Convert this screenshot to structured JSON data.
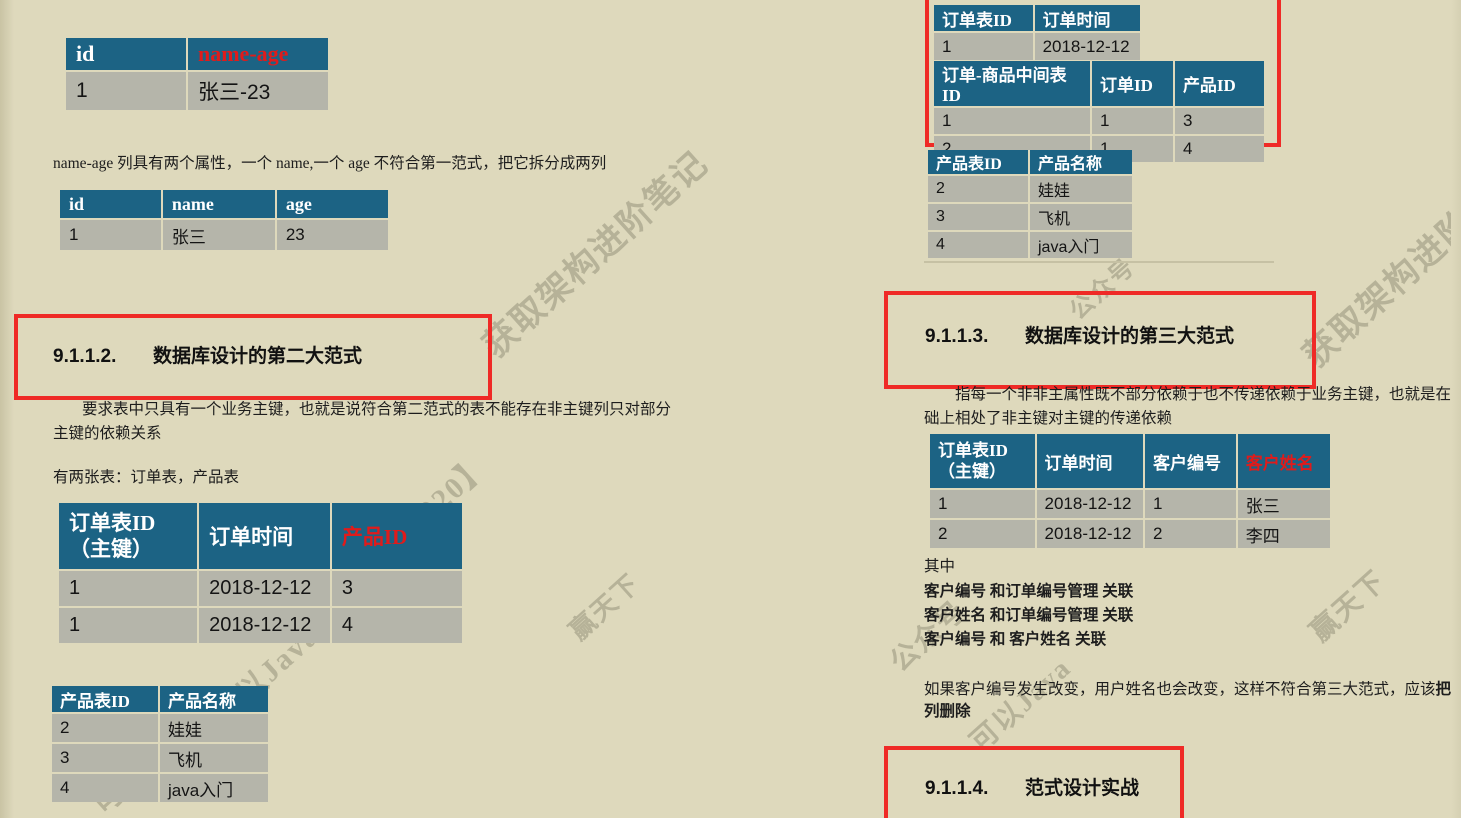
{
  "page": {
    "background_color": "#ded9bc",
    "table_header_color": "#1c6384",
    "table_row_color": "#b5b5aa",
    "accent_red": "#e01b1b",
    "highlight_box_color": "#ef2a26"
  },
  "watermarks": [
    {
      "text": "获取架构进阶笔记"
    },
    {
      "text": "可以Java"
    },
    {
      "text": "公众号"
    },
    {
      "text": "【2020】"
    },
    {
      "text": "赢天下"
    }
  ],
  "left_column": {
    "table_nameage": {
      "headers": [
        "id",
        "name-age"
      ],
      "header_colors": [
        "normal",
        "red"
      ],
      "rows": [
        {
          "cells": [
            "1",
            "张三-23"
          ],
          "cell_colors": [
            "normal",
            "red"
          ]
        }
      ]
    },
    "note_first_normal_form": "name-age 列具有两个属性，一个 name,一个 age 不符合第一范式，把它拆分成两列",
    "table_split": {
      "headers": [
        "id",
        "name",
        "age"
      ],
      "rows": [
        {
          "cells": [
            "1",
            "张三",
            "23"
          ]
        }
      ]
    },
    "heading_2nf": {
      "number": "9.1.1.2.",
      "title": "数据库设计的第二大范式"
    },
    "para_2nf_line1": "要求表中只具有一个业务主键，也就是说符合第二范式的表不能存在非主键列只对部分",
    "para_2nf_line2": "主键的依赖关系",
    "para_two_tables": "有两张表：订单表，产品表",
    "table_order_left": {
      "headers": [
        "订单表ID\n（主键）",
        "订单时间",
        "产品ID"
      ],
      "header_lines": [
        [
          "订单表ID",
          "（主键）"
        ],
        [
          "订单时间"
        ],
        [
          "产品ID"
        ]
      ],
      "header_colors": [
        "normal",
        "normal",
        "red"
      ],
      "rows": [
        {
          "cells": [
            "1",
            "2018-12-12",
            "3"
          ],
          "cell_colors": [
            "normal",
            "normal",
            "red"
          ]
        },
        {
          "cells": [
            "1",
            "2018-12-12",
            "4"
          ],
          "cell_colors": [
            "red",
            "normal",
            "red"
          ]
        }
      ]
    },
    "table_product_left": {
      "headers": [
        "产品表ID",
        "产品名称"
      ],
      "rows": [
        {
          "cells": [
            "2",
            "娃娃"
          ]
        },
        {
          "cells": [
            "3",
            "飞机"
          ]
        },
        {
          "cells": [
            "4",
            "java入门"
          ]
        }
      ]
    }
  },
  "right_column": {
    "table_order_top": {
      "headers": [
        "订单表ID",
        "订单时间"
      ],
      "rows": [
        {
          "cells": [
            "1",
            "2018-12-12"
          ]
        }
      ]
    },
    "table_order_product_link": {
      "headers": [
        "订单-商品中间表ID",
        "订单ID",
        "产品ID"
      ],
      "rows": [
        {
          "cells": [
            "1",
            "1",
            "3"
          ]
        },
        {
          "cells": [
            "2",
            "1",
            "4"
          ]
        }
      ]
    },
    "table_product_right": {
      "headers": [
        "产品表ID",
        "产品名称"
      ],
      "rows": [
        {
          "cells": [
            "2",
            "娃娃"
          ]
        },
        {
          "cells": [
            "3",
            "飞机"
          ]
        },
        {
          "cells": [
            "4",
            "java入门"
          ]
        }
      ]
    },
    "heading_3nf": {
      "number": "9.1.1.3.",
      "title": "数据库设计的第三大范式"
    },
    "para_3nf_line1": "指每一个非非主属性既不部分依赖于也不传递依赖于业务主键，也就是在第",
    "para_3nf_line2": "础上相处了非主键对主键的传递依赖",
    "table_customer": {
      "headers": [
        "订单表ID\n（主键）",
        "订单时间",
        "客户编号",
        "客户姓名"
      ],
      "header_lines": [
        [
          "订单表ID",
          "（主键）"
        ],
        [
          "订单时间"
        ],
        [
          "客户编号"
        ],
        [
          "客户姓名"
        ]
      ],
      "header_colors": [
        "normal",
        "normal",
        "normal",
        "red"
      ],
      "rows": [
        {
          "cells": [
            "1",
            "2018-12-12",
            "1",
            "张三"
          ],
          "cell_colors": [
            "normal",
            "normal",
            "normal",
            "red"
          ]
        },
        {
          "cells": [
            "2",
            "2018-12-12",
            "2",
            "李四"
          ],
          "cell_colors": [
            "normal",
            "normal",
            "normal",
            "red"
          ]
        }
      ]
    },
    "relations_label": "其中",
    "relations": [
      "客户编号  和订单编号管理  关联",
      "客户姓名  和订单编号管理  关联",
      "客户编号  和  客户姓名  关联"
    ],
    "para_conclusion_line1_plain": "如果客户编号发生改变，用户姓名也会改变，这样不符合第三大范式，应该",
    "para_conclusion_line1_bold": "把客",
    "para_conclusion_line2_bold": "列删除",
    "heading_practice": {
      "number": "9.1.1.4.",
      "title": "范式设计实战"
    }
  }
}
